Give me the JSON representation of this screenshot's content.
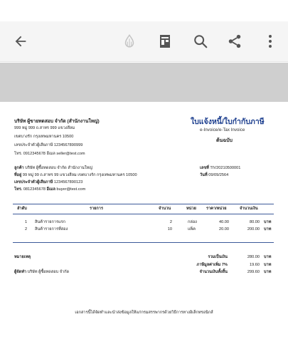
{
  "toolbar": {
    "back_icon": "arrow-left-icon",
    "ink_icon": "ink-drop-icon",
    "layout_icon": "document-layout-icon",
    "search_icon": "search-icon",
    "share_icon": "share-icon",
    "more_icon": "more-vertical-icon"
  },
  "seller": {
    "name": "บริษัท ผู้ขายทดสอบ จำกัด (สำนักงานใหญ่)",
    "address1": "999 หมู่ 999 ถ.สาทร 999 แขวงสีลม",
    "address2": "เขตบางรัก กรุงเทพมหานคร 10500",
    "tax_id": "เลขประจำตัวผู้เสียภาษี 1234567890999",
    "contact": "โทร. 0912345678  อีเมล seller@test.com"
  },
  "doc_title": {
    "main": "ใบแจ้งหนี้/ใบกำกับภาษี",
    "sub": "e-Invoice/e-Tax Invoice",
    "copy": "ต้นฉบับ"
  },
  "buyer": {
    "name_label": "ลูกค้า",
    "name_value": "บริษัท ผู้ซื้อทดสอบ จำกัด สำนักงานใหญ่",
    "address_label": "ที่อยู่",
    "address_value": "99 หมู่ 99 ถ.สาทร 99 แขวงสีลม เขตบางรัก กรุงเทพมหานคร 10500",
    "tax_label": "เลขประจำตัวผู้เสียภาษี",
    "tax_value": "1234567890123",
    "phone_label": "โทร.",
    "phone_value": "0812345678",
    "email_label": "อีเมล",
    "email_value": "buyer@test.com"
  },
  "invoice_meta": {
    "number_label": "เลขที่",
    "number_value": "TIV20210500001",
    "date_label": "วันที่",
    "date_value": "09/09/2564"
  },
  "table": {
    "headers": [
      "ลำดับ",
      "รายการ",
      "จำนวน",
      "หน่วย",
      "ราคา/หน่วย",
      "จำนวนเงิน"
    ],
    "rows": [
      {
        "no": "1",
        "item": "สินค้ารายการแรก",
        "qty": "2",
        "unit": "กล่อง",
        "price": "40.00",
        "amount": "80.00",
        "currency": "บาท"
      },
      {
        "no": "2",
        "item": "สินค้ารายการที่สอง",
        "qty": "10",
        "unit": "แพ็ค",
        "price": "20.00",
        "amount": "200.00",
        "currency": "บาท"
      }
    ]
  },
  "notes": {
    "remark_label": "หมายเหตุ",
    "issuer_label": "ผู้จัดทำ",
    "issuer_value": "บริษัท ผู้ซื้อทดสอบ จำกัด"
  },
  "totals": {
    "subtotal_label": "รวมเป็นเงิน",
    "subtotal_value": "280.00",
    "vat_label": "ภาษีมูลค่าเพิ่ม 7%",
    "vat_value": "19.60",
    "grand_label": "จำนวนเงินทั้งสิ้น",
    "grand_value": "299.60",
    "currency": "บาท"
  },
  "footer": {
    "text": "เอกสารนี้ได้จัดทำและนำส่งข้อมูลให้แก่กรมสรรพากรด้วยวิธีการทางอิเล็กทรอนิกส์"
  }
}
